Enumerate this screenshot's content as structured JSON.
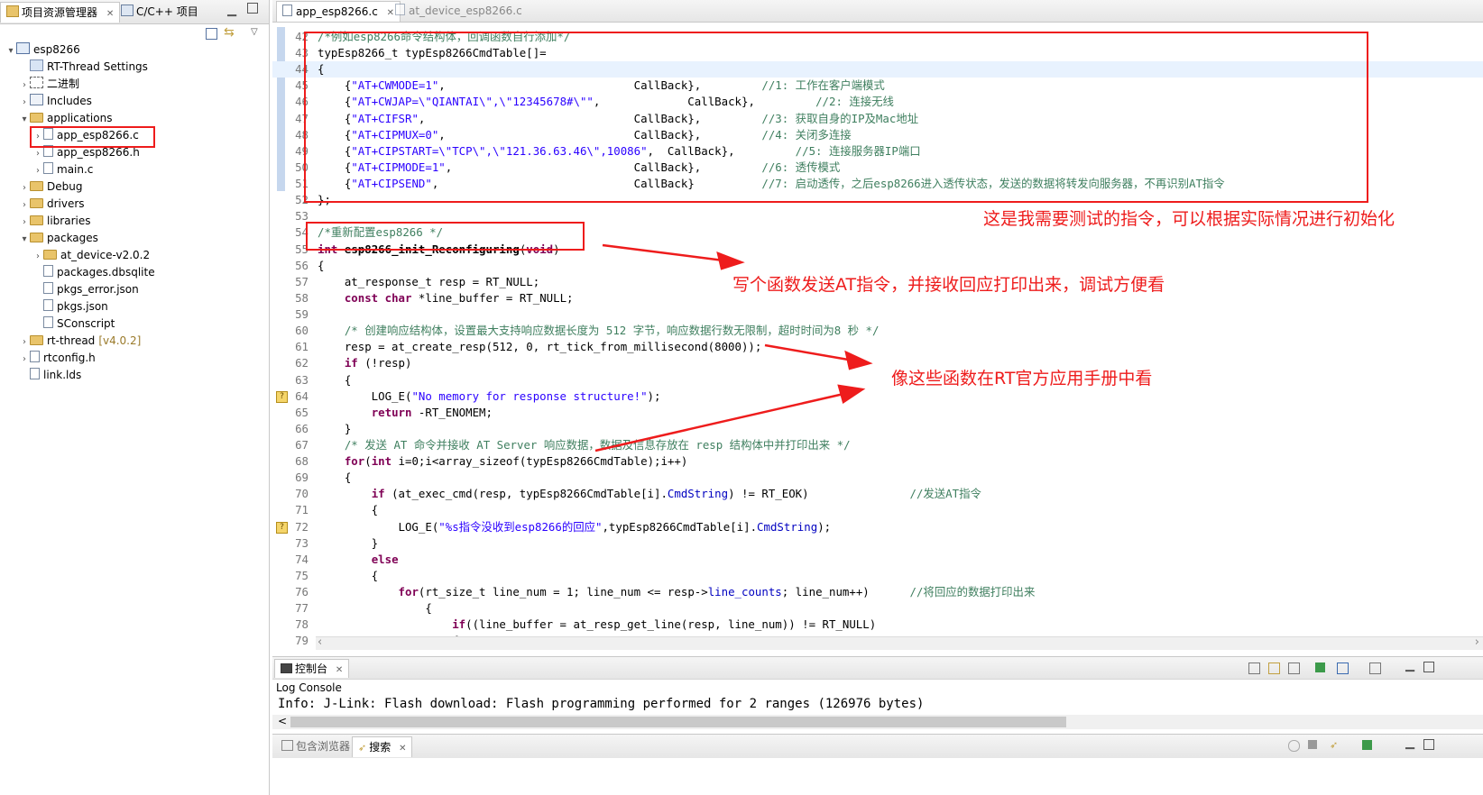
{
  "left_panel": {
    "tabs": [
      {
        "label": "项目资源管理器",
        "close": "✕"
      },
      {
        "label": "C/C++ 项目"
      }
    ],
    "tree": [
      {
        "label": "esp8266",
        "depth": 0,
        "twisty": "▾",
        "icon": "project-icon"
      },
      {
        "label": "RT-Thread Settings",
        "depth": 1,
        "twisty": "",
        "icon": "settings-icon"
      },
      {
        "label": "二进制",
        "depth": 1,
        "twisty": "›",
        "icon": "binary-icon"
      },
      {
        "label": "Includes",
        "depth": 1,
        "twisty": "›",
        "icon": "includes-icon"
      },
      {
        "label": "applications",
        "depth": 1,
        "twisty": "▾",
        "icon": "folder-icon"
      },
      {
        "label": "app_esp8266.c",
        "depth": 2,
        "twisty": "›",
        "icon": "c-file-icon"
      },
      {
        "label": "app_esp8266.h",
        "depth": 2,
        "twisty": "›",
        "icon": "h-file-icon"
      },
      {
        "label": "main.c",
        "depth": 2,
        "twisty": "›",
        "icon": "c-file-icon"
      },
      {
        "label": "Debug",
        "depth": 1,
        "twisty": "›",
        "icon": "folder-icon"
      },
      {
        "label": "drivers",
        "depth": 1,
        "twisty": "›",
        "icon": "folder-icon"
      },
      {
        "label": "libraries",
        "depth": 1,
        "twisty": "›",
        "icon": "folder-icon"
      },
      {
        "label": "packages",
        "depth": 1,
        "twisty": "▾",
        "icon": "folder-icon"
      },
      {
        "label": "at_device-v2.0.2",
        "depth": 2,
        "twisty": "›",
        "icon": "folder-icon"
      },
      {
        "label": "packages.dbsqlite",
        "depth": 2,
        "twisty": "",
        "icon": "file-icon"
      },
      {
        "label": "pkgs_error.json",
        "depth": 2,
        "twisty": "",
        "icon": "json-file-icon"
      },
      {
        "label": "pkgs.json",
        "depth": 2,
        "twisty": "",
        "icon": "json-file-icon"
      },
      {
        "label": "SConscript",
        "depth": 2,
        "twisty": "",
        "icon": "file-icon"
      },
      {
        "label": "rt-thread",
        "version": "[v4.0.2]",
        "depth": 1,
        "twisty": "›",
        "icon": "folder-icon"
      },
      {
        "label": "rtconfig.h",
        "depth": 1,
        "twisty": "›",
        "icon": "h-file-icon"
      },
      {
        "label": "link.lds",
        "depth": 1,
        "twisty": "",
        "icon": "linker-file-icon"
      }
    ]
  },
  "editor": {
    "tabs": [
      {
        "label": "app_esp8266.c",
        "close": "✕",
        "active": true
      },
      {
        "label": "at_device_esp8266.c",
        "active": false
      }
    ],
    "lines": [
      {
        "n": "42",
        "segs": [
          {
            "t": "/*例如esp8266命令结构体，回调函数自行添加*/",
            "c": "cm"
          }
        ]
      },
      {
        "n": "43",
        "segs": [
          {
            "t": "typEsp8266_t typEsp8266CmdTable[]=",
            "c": ""
          }
        ]
      },
      {
        "n": "44",
        "hl": true,
        "segs": [
          {
            "t": "{",
            "c": ""
          }
        ]
      },
      {
        "n": "45",
        "segs": [
          {
            "t": "    {",
            "c": ""
          },
          {
            "t": "\"AT+CWMODE=1\"",
            "c": "str"
          },
          {
            "t": ",                            CallBack},         ",
            "c": ""
          },
          {
            "t": "//1: 工作在客户端模式",
            "c": "cm"
          }
        ]
      },
      {
        "n": "46",
        "segs": [
          {
            "t": "    {",
            "c": ""
          },
          {
            "t": "\"AT+CWJAP=\\\"QIANTAI\\\",\\\"12345678#\\\"\"",
            "c": "str"
          },
          {
            "t": ",             CallBack},         ",
            "c": ""
          },
          {
            "t": "//2: 连接无线",
            "c": "cm"
          }
        ]
      },
      {
        "n": "47",
        "segs": [
          {
            "t": "    {",
            "c": ""
          },
          {
            "t": "\"AT+CIFSR\"",
            "c": "str"
          },
          {
            "t": ",                               CallBack},         ",
            "c": ""
          },
          {
            "t": "//3: 获取自身的IP及Mac地址",
            "c": "cm"
          }
        ]
      },
      {
        "n": "48",
        "segs": [
          {
            "t": "    {",
            "c": ""
          },
          {
            "t": "\"AT+CIPMUX=0\"",
            "c": "str"
          },
          {
            "t": ",                            CallBack},         ",
            "c": ""
          },
          {
            "t": "//4: 关闭多连接",
            "c": "cm"
          }
        ]
      },
      {
        "n": "49",
        "segs": [
          {
            "t": "    {",
            "c": ""
          },
          {
            "t": "\"AT+CIPSTART=\\\"TCP\\\",\\\"121.36.63.46\\\",10086\"",
            "c": "str"
          },
          {
            "t": ",  CallBack},         ",
            "c": ""
          },
          {
            "t": "//5: 连接服务器IP端口",
            "c": "cm"
          }
        ]
      },
      {
        "n": "50",
        "segs": [
          {
            "t": "    {",
            "c": ""
          },
          {
            "t": "\"AT+CIPMODE=1\"",
            "c": "str"
          },
          {
            "t": ",                           CallBack},         ",
            "c": ""
          },
          {
            "t": "//6: 透传模式",
            "c": "cm"
          }
        ]
      },
      {
        "n": "51",
        "segs": [
          {
            "t": "    {",
            "c": ""
          },
          {
            "t": "\"AT+CIPSEND\"",
            "c": "str"
          },
          {
            "t": ",                             CallBack}          ",
            "c": ""
          },
          {
            "t": "//7: 启动透传，之后esp8266进入透传状态，发送的数据将转发向服务器，不再识别AT指令",
            "c": "cm"
          }
        ]
      },
      {
        "n": "52",
        "segs": [
          {
            "t": "};",
            "c": ""
          }
        ]
      },
      {
        "n": "53",
        "segs": [
          {
            "t": "",
            "c": ""
          }
        ]
      },
      {
        "n": "54",
        "segs": [
          {
            "t": "/*重新配置esp8266 */",
            "c": "cm"
          }
        ]
      },
      {
        "n": "55",
        "segs": [
          {
            "t": "int",
            "c": "kw"
          },
          {
            "t": " ",
            "c": ""
          },
          {
            "t": "esp8266_init_Reconfiguring",
            "c": "fn"
          },
          {
            "t": "(",
            "c": ""
          },
          {
            "t": "void",
            "c": "kw"
          },
          {
            "t": ")",
            "c": ""
          }
        ]
      },
      {
        "n": "56",
        "segs": [
          {
            "t": "{",
            "c": ""
          }
        ]
      },
      {
        "n": "57",
        "segs": [
          {
            "t": "    at_response_t resp = RT_NULL;",
            "c": ""
          }
        ]
      },
      {
        "n": "58",
        "segs": [
          {
            "t": "    ",
            "c": ""
          },
          {
            "t": "const",
            "c": "kw"
          },
          {
            "t": " ",
            "c": ""
          },
          {
            "t": "char",
            "c": "kw"
          },
          {
            "t": " *line_buffer = RT_NULL;",
            "c": ""
          }
        ]
      },
      {
        "n": "59",
        "segs": [
          {
            "t": "",
            "c": ""
          }
        ]
      },
      {
        "n": "60",
        "segs": [
          {
            "t": "    /* 创建响应结构体，设置最大支持响应数据长度为 512 字节，响应数据行数无限制，超时时间为8 秒 */",
            "c": "cm"
          }
        ]
      },
      {
        "n": "61",
        "segs": [
          {
            "t": "    resp = at_create_resp(512, 0, rt_tick_from_millisecond(8000));",
            "c": ""
          }
        ]
      },
      {
        "n": "62",
        "segs": [
          {
            "t": "    ",
            "c": ""
          },
          {
            "t": "if",
            "c": "kw"
          },
          {
            "t": " (!resp)",
            "c": ""
          }
        ]
      },
      {
        "n": "63",
        "segs": [
          {
            "t": "    {",
            "c": ""
          }
        ]
      },
      {
        "n": "64",
        "warn": true,
        "segs": [
          {
            "t": "        LOG_E(",
            "c": ""
          },
          {
            "t": "\"No memory for response structure!\"",
            "c": "str"
          },
          {
            "t": ");",
            "c": ""
          }
        ]
      },
      {
        "n": "65",
        "segs": [
          {
            "t": "        ",
            "c": ""
          },
          {
            "t": "return",
            "c": "kw"
          },
          {
            "t": " -RT_ENOMEM;",
            "c": ""
          }
        ]
      },
      {
        "n": "66",
        "segs": [
          {
            "t": "    }",
            "c": ""
          }
        ]
      },
      {
        "n": "67",
        "segs": [
          {
            "t": "    /* 发送 AT 命令并接收 AT Server 响应数据，数据及信息存放在 resp 结构体中并打印出来 */",
            "c": "cm"
          }
        ]
      },
      {
        "n": "68",
        "segs": [
          {
            "t": "    ",
            "c": ""
          },
          {
            "t": "for",
            "c": "kw"
          },
          {
            "t": "(",
            "c": ""
          },
          {
            "t": "int",
            "c": "kw"
          },
          {
            "t": " i=0;i<array_sizeof(typEsp8266CmdTable);i++)",
            "c": ""
          }
        ]
      },
      {
        "n": "69",
        "segs": [
          {
            "t": "    {",
            "c": ""
          }
        ]
      },
      {
        "n": "70",
        "segs": [
          {
            "t": "        ",
            "c": ""
          },
          {
            "t": "if",
            "c": "kw"
          },
          {
            "t": " (at_exec_cmd(resp, typEsp8266CmdTable[i].",
            "c": ""
          },
          {
            "t": "CmdString",
            "c": "fld"
          },
          {
            "t": ") != RT_EOK)               ",
            "c": ""
          },
          {
            "t": "//发送AT指令",
            "c": "cm"
          }
        ]
      },
      {
        "n": "71",
        "segs": [
          {
            "t": "        {",
            "c": ""
          }
        ]
      },
      {
        "n": "72",
        "warn": true,
        "segs": [
          {
            "t": "            LOG_E(",
            "c": ""
          },
          {
            "t": "\"%s指令没收到esp8266的回应\"",
            "c": "str"
          },
          {
            "t": ",typEsp8266CmdTable[i].",
            "c": ""
          },
          {
            "t": "CmdString",
            "c": "fld"
          },
          {
            "t": ");",
            "c": ""
          }
        ]
      },
      {
        "n": "73",
        "segs": [
          {
            "t": "        }",
            "c": ""
          }
        ]
      },
      {
        "n": "74",
        "segs": [
          {
            "t": "        ",
            "c": ""
          },
          {
            "t": "else",
            "c": "kw"
          }
        ]
      },
      {
        "n": "75",
        "segs": [
          {
            "t": "        {",
            "c": ""
          }
        ]
      },
      {
        "n": "76",
        "segs": [
          {
            "t": "            ",
            "c": ""
          },
          {
            "t": "for",
            "c": "kw"
          },
          {
            "t": "(rt_size_t line_num = 1; line_num <= resp->",
            "c": ""
          },
          {
            "t": "line_counts",
            "c": "fld"
          },
          {
            "t": "; line_num++)      ",
            "c": ""
          },
          {
            "t": "//将回应的数据打印出来",
            "c": "cm"
          }
        ]
      },
      {
        "n": "77",
        "segs": [
          {
            "t": "                {",
            "c": ""
          }
        ]
      },
      {
        "n": "78",
        "segs": [
          {
            "t": "                    ",
            "c": ""
          },
          {
            "t": "if",
            "c": "kw"
          },
          {
            "t": "((line_buffer = at_resp_get_line(resp, line_num)) != RT_NULL)",
            "c": ""
          }
        ]
      },
      {
        "n": "79",
        "segs": [
          {
            "t": "                    {",
            "c": ""
          }
        ]
      }
    ]
  },
  "annotations": {
    "a1": "这是我需要测试的指令，可以根据实际情况进行初始化",
    "a2": "写个函数发送AT指令，并接收回应打印出来，调试方便看",
    "a3": "像这些函数在RT官方应用手册中看"
  },
  "console": {
    "tab_label": "控制台",
    "close": "✕",
    "title": "Log Console",
    "output": "Info: J-Link: Flash download: Flash programming performed for 2 ranges (126976 bytes)",
    "scroll_left": "<"
  },
  "bottom_tabs": [
    {
      "label": "包含浏览器"
    },
    {
      "label": "搜索",
      "close": "✕"
    }
  ],
  "scroll": {
    "left": "‹",
    "right": "›"
  },
  "colors": {
    "annotation": "#ee1c1c",
    "keyword": "#7f0055",
    "string": "#2a00ff",
    "comment": "#3f7f5f"
  }
}
